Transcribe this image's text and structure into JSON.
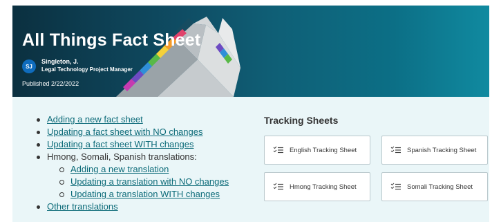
{
  "header": {
    "title": "All Things Fact Sheet",
    "author": {
      "initials": "SJ",
      "name": "Singleton, J.",
      "role": "Legal Technology Project Manager"
    },
    "published": "Published 2/22/2022"
  },
  "links": [
    {
      "text": "Adding a new fact sheet",
      "type": "link",
      "level": 1
    },
    {
      "text": "Updating a fact sheet with NO changes",
      "type": "link",
      "level": 1
    },
    {
      "text": "Updating a fact sheet WITH changes",
      "type": "link",
      "level": 1
    },
    {
      "text": "Hmong, Somali, Spanish translations:",
      "type": "text",
      "level": 1
    },
    {
      "text": "Adding a new translation",
      "type": "link",
      "level": 2
    },
    {
      "text": "Updating a translation with NO changes",
      "type": "link",
      "level": 2
    },
    {
      "text": "Updating a translation WITH changes",
      "type": "link",
      "level": 2
    },
    {
      "text": "Other translations",
      "type": "link",
      "level": 1
    }
  ],
  "tracking": {
    "heading": "Tracking Sheets",
    "tiles": [
      {
        "label": "English Tracking Sheet",
        "icon": "checklist-icon"
      },
      {
        "label": "Spanish Tracking Sheet",
        "icon": "checklist-icon"
      },
      {
        "label": "Hmong Tracking Sheet",
        "icon": "checklist-icon"
      },
      {
        "label": "Somali Tracking Sheet",
        "icon": "checklist-icon"
      }
    ]
  },
  "colors": {
    "link": "#0b6a78",
    "avatar": "#0f6cbd",
    "page_background": "#eaf6f8"
  }
}
